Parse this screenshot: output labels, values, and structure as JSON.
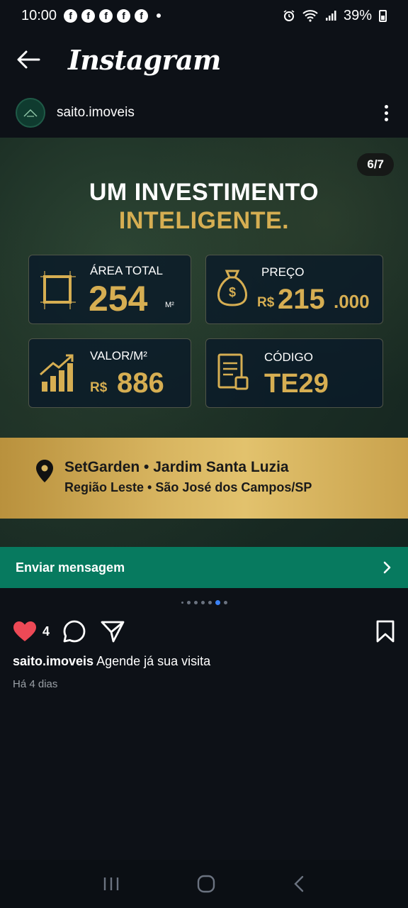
{
  "status_bar": {
    "time": "10:00",
    "battery": "39%",
    "fb_letter": "f"
  },
  "app": {
    "title": "Instagram"
  },
  "post": {
    "username": "saito.imoveis",
    "slide_counter": "6/7",
    "headline_line1": "UM INVESTIMENTO",
    "headline_line2": "INTELIGENTE.",
    "cards": {
      "area": {
        "label": "ÁREA TOTAL",
        "value": "254",
        "unit": "M²"
      },
      "price": {
        "label": "PREÇO",
        "currency": "R$",
        "value": "215",
        "suffix": ".000"
      },
      "per_m2": {
        "label": "VALOR/M²",
        "currency": "R$",
        "value": "886"
      },
      "code": {
        "label": "CÓDIGO",
        "value": "TE29"
      }
    },
    "location": {
      "line1": "SetGarden • Jardim Santa Luzia",
      "line2": "Região Leste • São José dos Campos/SP"
    },
    "send_message": "Enviar mensagem",
    "carousel": {
      "total": 7,
      "current": 6
    },
    "likes": "4",
    "caption_user": "saito.imoveis",
    "caption_text": "Agende já sua visita",
    "time_ago": "Há 4 dias"
  },
  "colors": {
    "accent_gold": "#d6ae52",
    "cta_green": "#077a5f",
    "like_red": "#ed4956",
    "active_dot": "#3b82f6"
  }
}
